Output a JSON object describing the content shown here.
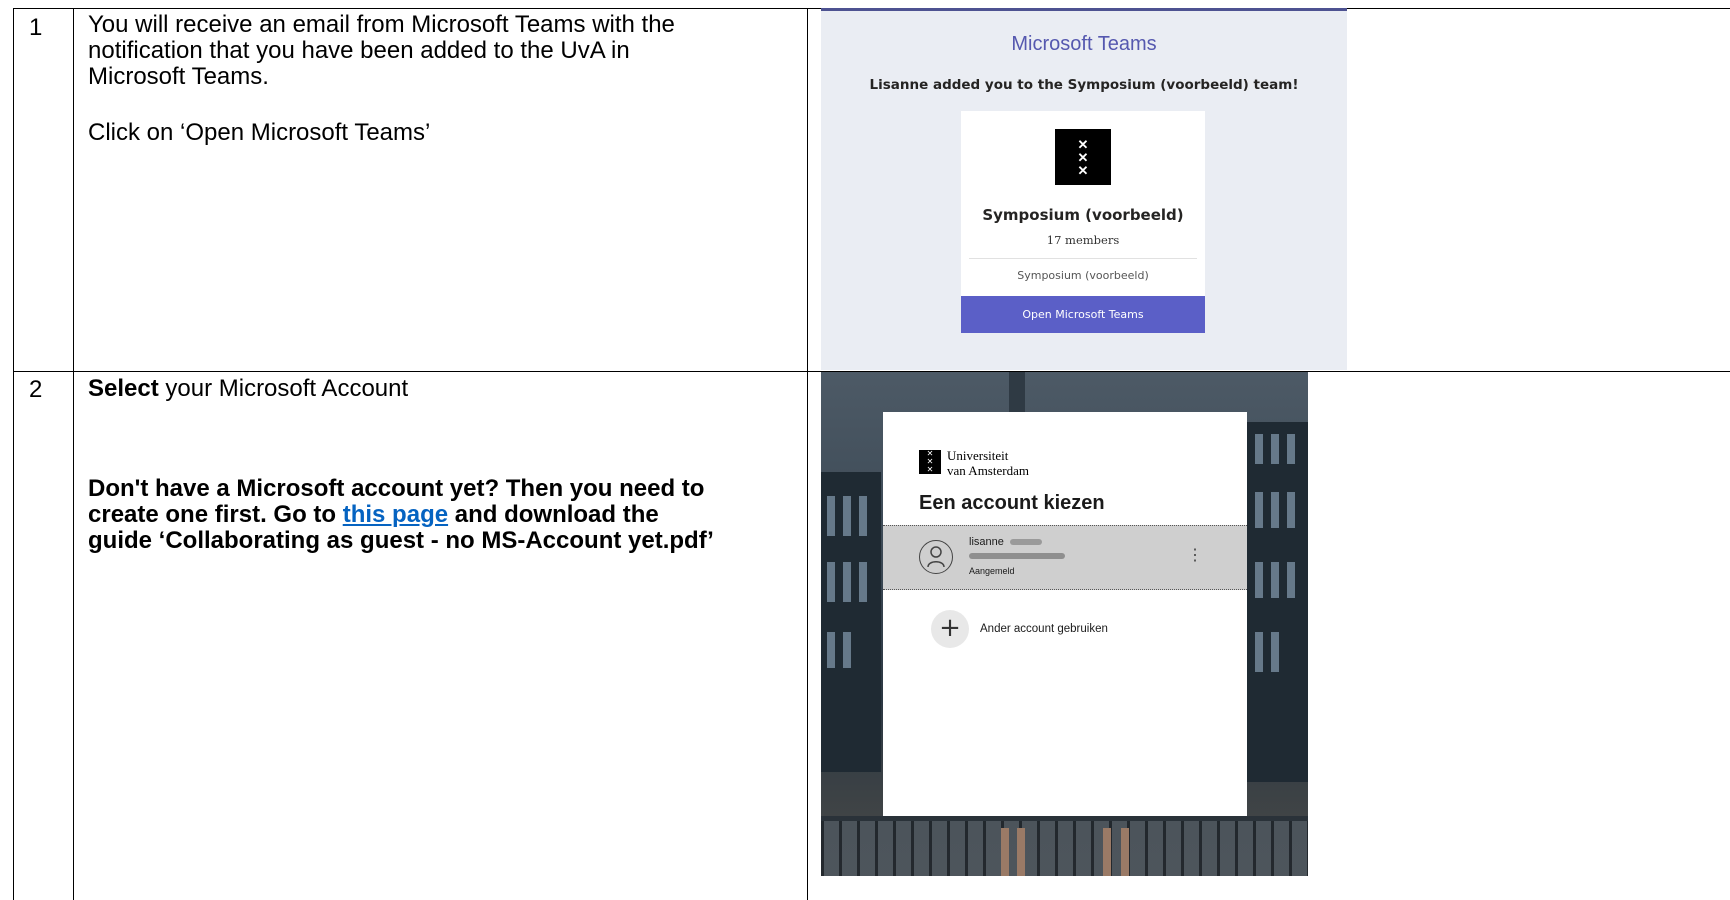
{
  "steps": [
    {
      "number": "1",
      "lines": [
        "You will receive an email from Microsoft Teams with the",
        "notification that you have been added to the UvA in",
        "Microsoft Teams."
      ],
      "instruction": "Click on ‘Open Microsoft Teams’",
      "screenshot": {
        "header": "Microsoft Teams",
        "message": "Lisanne added you to the Symposium (voorbeeld) team!",
        "team_name": "Symposium (voorbeeld)",
        "members": "17 members",
        "team_subtitle": "Symposium (voorbeeld)",
        "button_label": "Open Microsoft Teams"
      }
    },
    {
      "number": "2",
      "select_bold": "Select",
      "select_rest": " your Microsoft Account",
      "note_part1": "Don't have a Microsoft account yet? Then you need to",
      "note_part2": "create one first. Go to ",
      "note_link": "this page",
      "note_part3": " and download the",
      "note_part4": "guide ‘Collaborating as guest - no MS-Account yet.pdf’",
      "screenshot": {
        "org_line1": "Universiteit",
        "org_line2": "van Amsterdam",
        "title": "Een account kiezen",
        "account_name": "lisanne",
        "account_status": "Aangemeld",
        "other_account_label": "Ander account gebruiken"
      }
    }
  ],
  "icons": {
    "uva_logo": "uva-crosses-icon",
    "avatar": "person-icon",
    "more": "kebab-menu-icon",
    "add": "plus-icon"
  },
  "colors": {
    "teams_accent": "#5b5fc7",
    "link": "#0563c1"
  }
}
